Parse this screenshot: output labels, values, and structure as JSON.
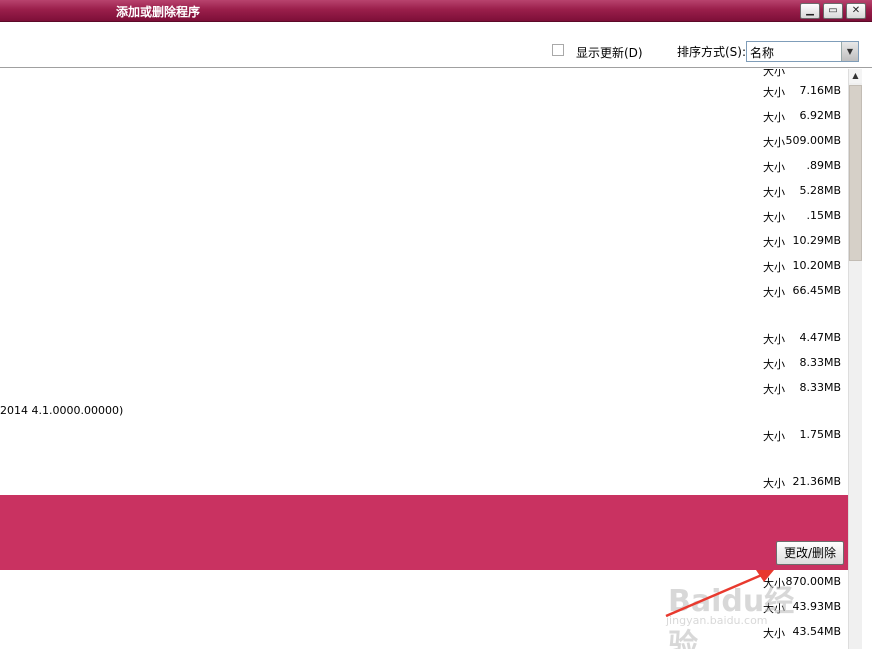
{
  "window": {
    "title": "添加或删除程序",
    "minimize": "▁",
    "maximize": "▭",
    "close": "✕"
  },
  "toolbar": {
    "show_updates": "显示更新(D)",
    "sort_label": "排序方式(S):",
    "sort_value": "名称",
    "show_updates_checked": false
  },
  "list": {
    "size_label": "大小",
    "rows": [
      {
        "size": "7.16MB"
      },
      {
        "size": "6.92MB"
      },
      {
        "size": "509.00MB"
      },
      {
        "size": ".89MB"
      },
      {
        "size": "5.28MB"
      },
      {
        "size": ".15MB"
      },
      {
        "size": "10.29MB"
      },
      {
        "size": "10.20MB"
      },
      {
        "size": "66.45MB"
      },
      {
        "size": "4.47MB"
      },
      {
        "size": "8.33MB"
      },
      {
        "size": "8.33MB"
      },
      {
        "size": "1.75MB"
      },
      {
        "size": "21.36MB"
      },
      {
        "size": "870.00MB"
      },
      {
        "size": "43.93MB"
      },
      {
        "size": "43.54MB"
      }
    ],
    "partial_name": "2014 4.1.0000.00000)",
    "change_remove_button": "更改/删除",
    "selected_color": "#c93261"
  },
  "watermark": {
    "text": "Baidu经验",
    "sub": "jingyan.baidu.com"
  },
  "colors": {
    "titlebar": "#9a1f4b",
    "arrow": "#e8392e"
  }
}
